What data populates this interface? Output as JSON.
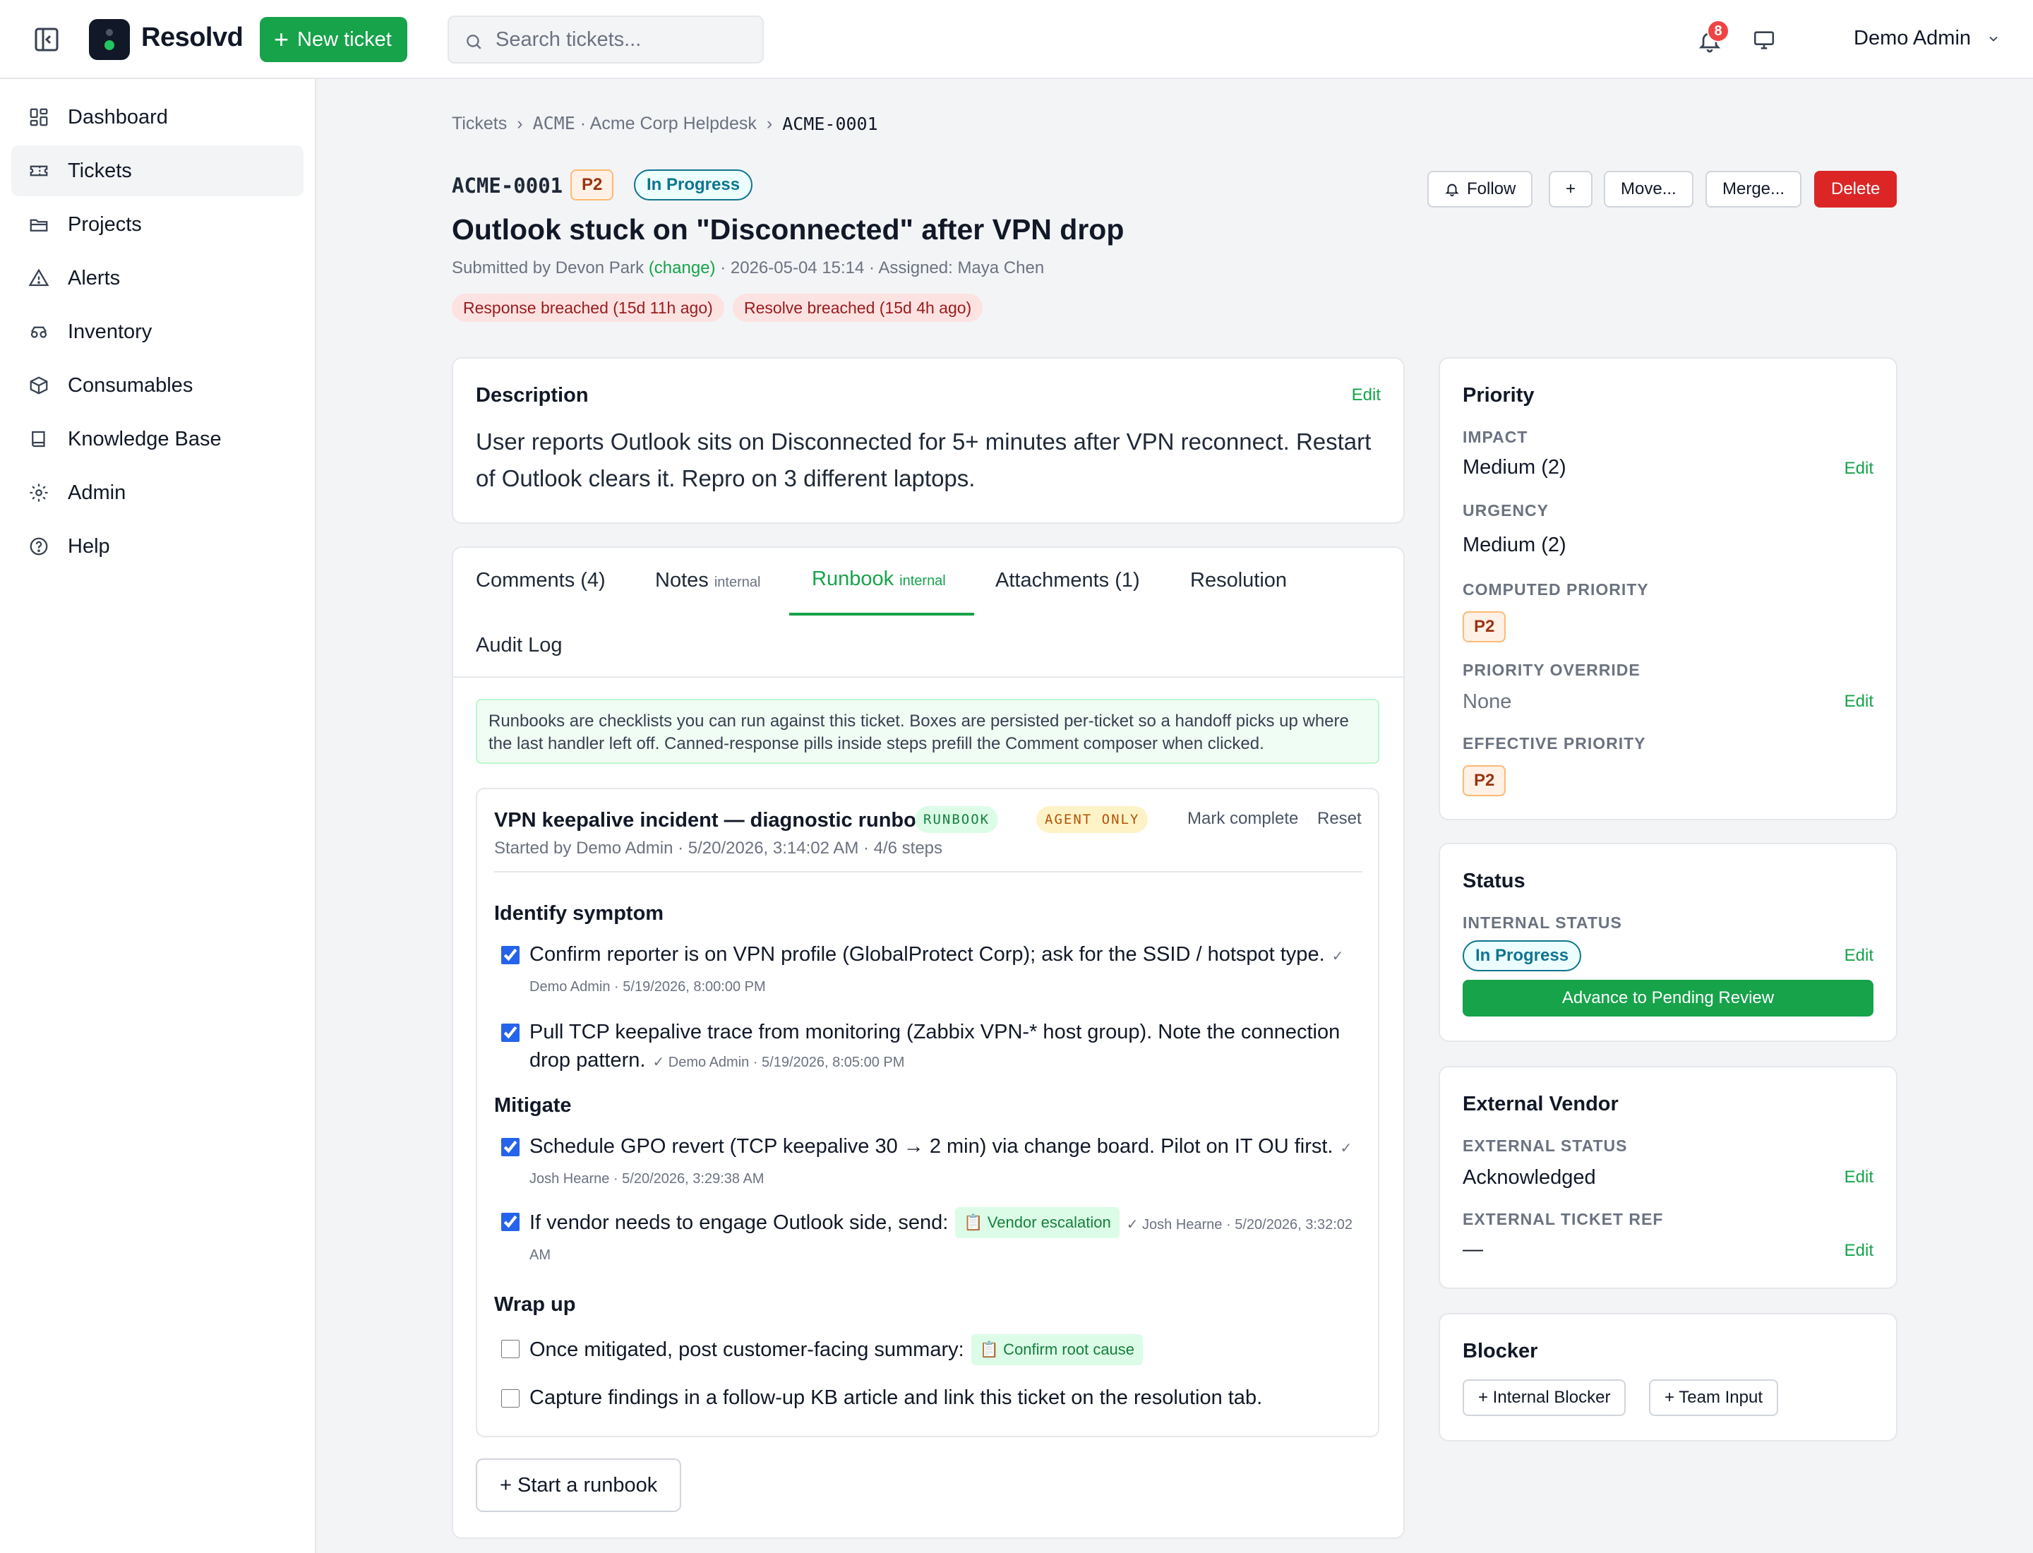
{
  "topbar": {
    "brand": "Resolvd",
    "new_ticket_label": "New ticket",
    "search_placeholder": "Search tickets...",
    "notifications_count": "8",
    "user_name": "Demo Admin"
  },
  "sidebar": {
    "items": [
      {
        "label": "Dashboard",
        "icon": "dashboard-icon"
      },
      {
        "label": "Tickets",
        "icon": "ticket-icon",
        "active": true
      },
      {
        "label": "Projects",
        "icon": "folder-icon"
      },
      {
        "label": "Alerts",
        "icon": "alert-triangle-icon"
      },
      {
        "label": "Inventory",
        "icon": "inventory-icon"
      },
      {
        "label": "Consumables",
        "icon": "box-icon"
      },
      {
        "label": "Knowledge Base",
        "icon": "book-icon"
      },
      {
        "label": "Admin",
        "icon": "gear-icon"
      },
      {
        "label": "Help",
        "icon": "help-circle-icon"
      }
    ]
  },
  "breadcrumb": {
    "root": "Tickets",
    "project": "ACME · Acme Corp Helpdesk",
    "project_code": "ACME",
    "project_name": "· Acme Corp Helpdesk",
    "current": "ACME-0001",
    "separator": "›"
  },
  "ticket": {
    "id": "ACME-0001",
    "priority": "P2",
    "status": "In Progress",
    "title": "Outlook stuck on \"Disconnected\" after VPN drop",
    "submitted_prefix": "Submitted by Devon Park",
    "change_label": "(change)",
    "submitted_suffix": "· 2026-05-04 15:14 · Assigned: Maya Chen",
    "sla": [
      "Response breached (15d 11h ago)",
      "Resolve breached (15d 4h ago)"
    ]
  },
  "actions": {
    "follow": "Follow",
    "plus": "+",
    "move": "Move...",
    "merge": "Merge...",
    "delete": "Delete"
  },
  "description": {
    "heading": "Description",
    "edit": "Edit",
    "body": "User reports Outlook sits on Disconnected for 5+ minutes after VPN reconnect. Restart of Outlook clears it. Repro on 3 different laptops."
  },
  "tabs": [
    {
      "label": "Comments (4)",
      "suffix": ""
    },
    {
      "label": "Notes",
      "suffix": "internal"
    },
    {
      "label": "Runbook",
      "suffix": "internal",
      "active": true
    },
    {
      "label": "Attachments (1)",
      "suffix": ""
    },
    {
      "label": "Resolution",
      "suffix": ""
    },
    {
      "label": "Audit Log",
      "suffix": ""
    }
  ],
  "runbook_info": "Runbooks are checklists you can run against this ticket. Boxes are persisted per-ticket so a handoff picks up where the last handler left off. Canned-response pills inside steps prefill the Comment composer when clicked.",
  "runbook": {
    "title": "VPN keepalive incident — diagnostic runbook",
    "tag_runbook": "RUNBOOK",
    "tag_agent": "AGENT ONLY",
    "mark_complete": "Mark complete",
    "reset": "Reset",
    "started": "Started by Demo Admin · 5/20/2026, 3:14:02 AM · 4/6 steps",
    "sections": [
      {
        "title": "Identify symptom",
        "steps": [
          {
            "text": "Confirm reporter is on VPN profile (GlobalProtect Corp); ask for the SSID / hotspot type.",
            "done": true,
            "who": "✓ Demo Admin · 5/19/2026, 8:00:00 PM"
          },
          {
            "text": "Pull TCP keepalive trace from monitoring (Zabbix VPN-* host group). Note the connection drop pattern.",
            "done": true,
            "who": "✓ Demo Admin · 5/19/2026, 8:05:00 PM"
          }
        ]
      },
      {
        "title": "Mitigate",
        "steps": [
          {
            "text": "Schedule GPO revert (TCP keepalive 30 → 2 min) via change board. Pilot on IT OU first.",
            "done": true,
            "who": "✓ Josh Hearne · 5/20/2026, 3:29:38 AM"
          },
          {
            "text": "If vendor needs to engage Outlook side, send:",
            "done": true,
            "canned": "📋 Vendor escalation",
            "who": "✓ Josh Hearne · 5/20/2026, 3:32:02 AM"
          }
        ]
      },
      {
        "title": "Wrap up",
        "steps": [
          {
            "text": "Once mitigated, post customer-facing summary:",
            "done": false,
            "canned": "📋 Confirm root cause"
          },
          {
            "text": "Capture findings in a follow-up KB article and link this ticket on the resolution tab.",
            "done": false
          }
        ]
      }
    ],
    "start_label": "+ Start a runbook"
  },
  "priority_card": {
    "heading": "Priority",
    "impact_label": "IMPACT",
    "impact": "Medium (2)",
    "urgency_label": "URGENCY",
    "urgency": "Medium (2)",
    "computed_label": "COMPUTED PRIORITY",
    "computed": "P2",
    "override_label": "PRIORITY OVERRIDE",
    "override": "None",
    "effective_label": "EFFECTIVE PRIORITY",
    "effective": "P2",
    "edit": "Edit"
  },
  "status_card": {
    "heading": "Status",
    "internal_label": "INTERNAL STATUS",
    "internal": "In Progress",
    "advance": "Advance to Pending Review",
    "edit": "Edit"
  },
  "vendor_card": {
    "heading": "External Vendor",
    "status_label": "EXTERNAL STATUS",
    "status": "Acknowledged",
    "ref_label": "EXTERNAL TICKET REF",
    "ref": "—",
    "edit": "Edit"
  },
  "blocker_card": {
    "heading": "Blocker",
    "internal": "+ Internal Blocker",
    "team": "+ Team Input"
  },
  "colors": {
    "accent": "#16a34a",
    "danger": "#dc2626",
    "status": "#0e7490",
    "priority": "#9a3412"
  }
}
